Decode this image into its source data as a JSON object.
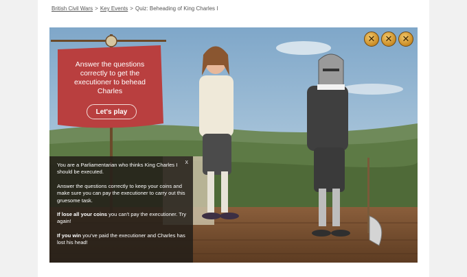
{
  "breadcrumb": {
    "item1": "British Civil Wars",
    "item2": "Key Events",
    "current": "Quiz: Beheading of King Charles I",
    "separator": ">"
  },
  "game": {
    "banner_text": "Answer the questions correctly to get the executioner to behead Charles",
    "play_label": "Let's play",
    "coins": [
      "✕",
      "✕",
      "✕"
    ],
    "info": {
      "close": "x",
      "p1": "You are a Parliamentarian who thinks King Charles I should be executed.",
      "p2": "Answer the questions correctly to keep your coins and make sure you can pay the executioner to carry out this gruesome task.",
      "p3_bold": "If lose all your coins",
      "p3_rest": " you can't pay the executioner. Try again!",
      "p4_bold": "If you win",
      "p4_rest": " you've paid the executioner and Charles has lost his head!"
    }
  }
}
